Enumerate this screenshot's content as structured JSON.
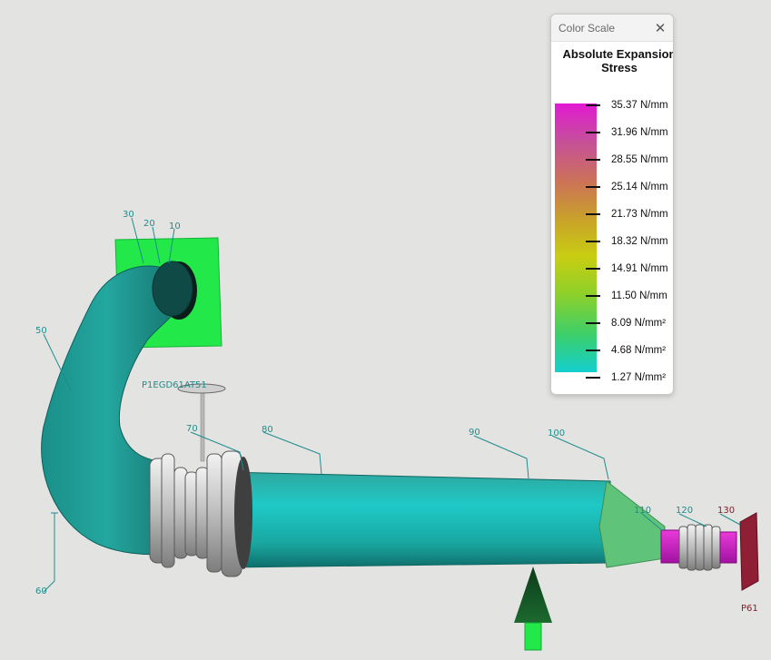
{
  "color_scale": {
    "window_title": "Color Scale",
    "close_glyph": "✕",
    "heading_line1": "Absolute Expansion",
    "heading_line2": "Stress",
    "labels": [
      "35.37 N/mm",
      "31.96 N/mm",
      "28.55 N/mm",
      "25.14 N/mm",
      "21.73 N/mm",
      "18.32 N/mm",
      "14.91 N/mm",
      "11.50 N/mm",
      "8.09 N/mm²",
      "4.68 N/mm²",
      "1.27 N/mm²"
    ],
    "gradient_colors": [
      "#e21ad3",
      "#c54f9a",
      "#cc7258",
      "#c9a12a",
      "#c8cd12",
      "#8dd02a",
      "#3ccf6a",
      "#14cfcf"
    ]
  },
  "model": {
    "nodes": {
      "n10": "10",
      "n20": "20",
      "n30": "30",
      "n50": "50",
      "n60": "60",
      "n70": "70",
      "n80": "80",
      "n90": "90",
      "n100": "100",
      "n110": "110",
      "n120": "120",
      "n130": "130"
    },
    "tags": {
      "valve_tag": "P1EGD61AT51",
      "anchor_tag": "P61"
    },
    "colors": {
      "pipe": "#1fa9a2",
      "nozzle_plate": "#22e84a",
      "reducer": "#5fc47a",
      "expansion_joint": "#d7d7d7",
      "hot_segment": "#d11bc6",
      "anchor_plate": "#8e1f35",
      "support_arrow": "#0d3b1a"
    }
  }
}
